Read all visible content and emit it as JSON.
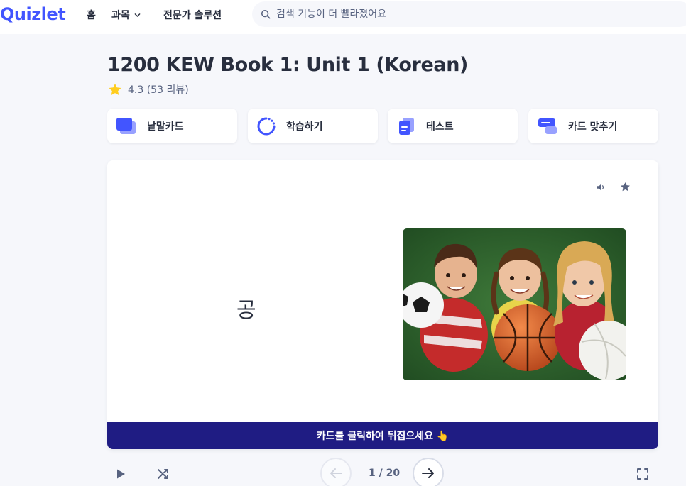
{
  "header": {
    "logo": "Quizlet",
    "nav": [
      {
        "label": "홈"
      },
      {
        "label": "과목"
      },
      {
        "label": "전문가 솔루션"
      }
    ],
    "search": {
      "placeholder": "검색 기능이 더 빨라졌어요"
    }
  },
  "set": {
    "title": "1200 KEW Book 1: Unit 1 (Korean)",
    "rating": "4.3 (53 리뷰)"
  },
  "modes": [
    {
      "label": "낱말카드",
      "icon": "flashcards-icon"
    },
    {
      "label": "학습하기",
      "icon": "learn-icon"
    },
    {
      "label": "테스트",
      "icon": "test-icon"
    },
    {
      "label": "카드 맞추기",
      "icon": "match-icon"
    }
  ],
  "card": {
    "term": "공",
    "hint": "카드를 클릭하여 뒤집으세요 👆"
  },
  "controls": {
    "counter": "1 / 20"
  },
  "colors": {
    "brand": "#4255ff",
    "hint_bar": "#1f1c83",
    "background": "#f6f7fb"
  }
}
